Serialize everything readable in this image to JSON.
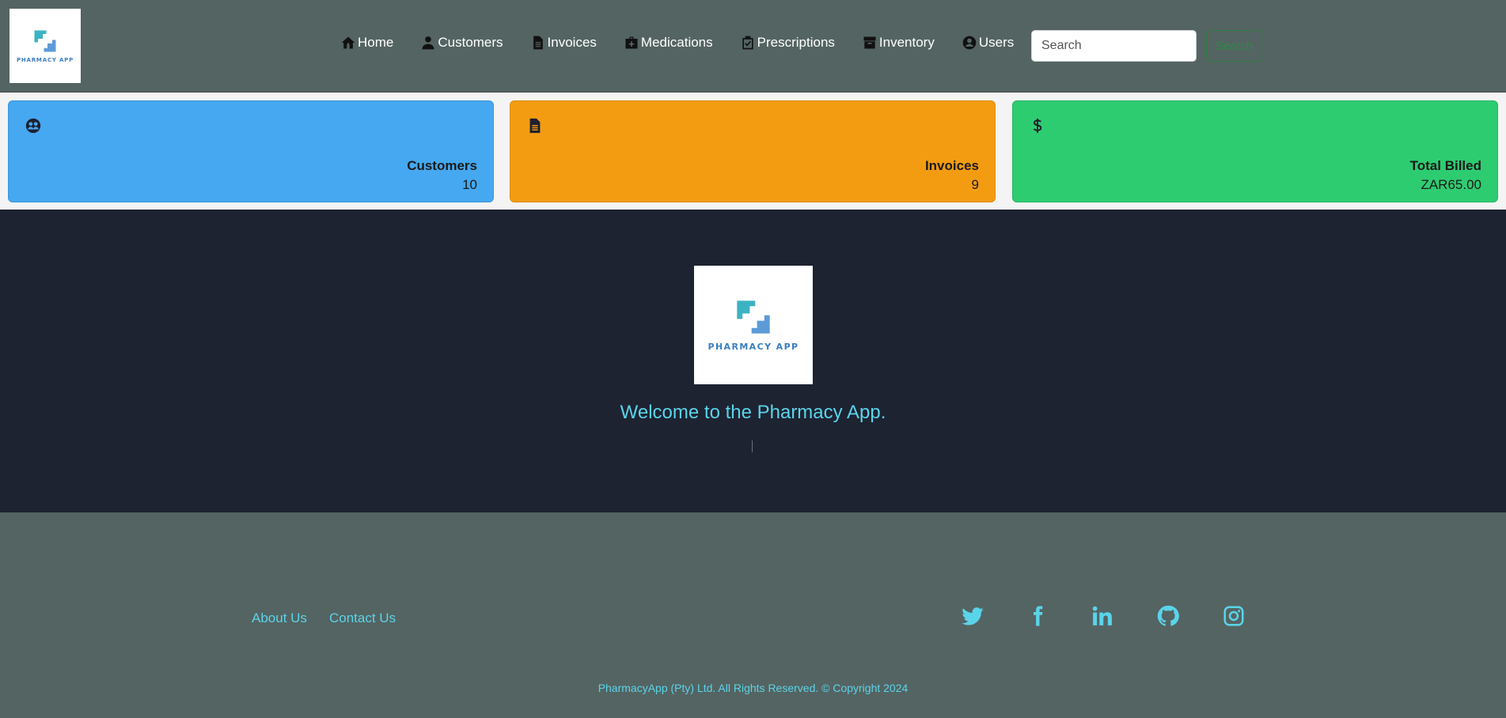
{
  "brand": {
    "logo_text": "PHARMACY APP",
    "colors": {
      "logo_teal": "#3bb3c3",
      "logo_blue": "#5d9bd8",
      "logo_navy": "#3a7fc1"
    }
  },
  "nav": {
    "items": [
      {
        "label": "Home",
        "icon": "home-icon"
      },
      {
        "label": "Customers",
        "icon": "person-icon"
      },
      {
        "label": "Invoices",
        "icon": "document-icon"
      },
      {
        "label": "Medications",
        "icon": "medkit-icon"
      },
      {
        "label": "Prescriptions",
        "icon": "clipboard-check-icon"
      },
      {
        "label": "Inventory",
        "icon": "archive-icon"
      },
      {
        "label": "Users",
        "icon": "user-circle-icon"
      }
    ],
    "search": {
      "placeholder": "Search",
      "value": "",
      "button_label": "Search"
    },
    "colors": {
      "background": "#546462",
      "search_button": "#2c8a46"
    }
  },
  "stats": {
    "customers": {
      "title": "Customers",
      "value": "10",
      "icon": "users-group-icon",
      "color": "#45a8f0"
    },
    "invoices": {
      "title": "Invoices",
      "value": "9",
      "icon": "document-icon",
      "color": "#f39c12"
    },
    "total_billed": {
      "title": "Total Billed",
      "value": "ZAR65.00",
      "icon": "dollar-icon",
      "color": "#2ecc71"
    }
  },
  "hero": {
    "title": "Welcome to the Pharmacy App.",
    "logo_text": "PHARMACY APP",
    "colors": {
      "background": "#1e2331",
      "title": "#5ad4ea"
    }
  },
  "footer": {
    "links": [
      {
        "label": "About Us"
      },
      {
        "label": "Contact Us"
      }
    ],
    "social": [
      {
        "icon": "twitter-icon"
      },
      {
        "icon": "facebook-icon"
      },
      {
        "icon": "linkedin-icon"
      },
      {
        "icon": "github-icon"
      },
      {
        "icon": "instagram-icon"
      }
    ],
    "copyright": "PharmacyApp (Pty) Ltd. All Rights Reserved. © Copyright 2024",
    "colors": {
      "background": "#546462",
      "text": "#5ad4ea"
    }
  }
}
